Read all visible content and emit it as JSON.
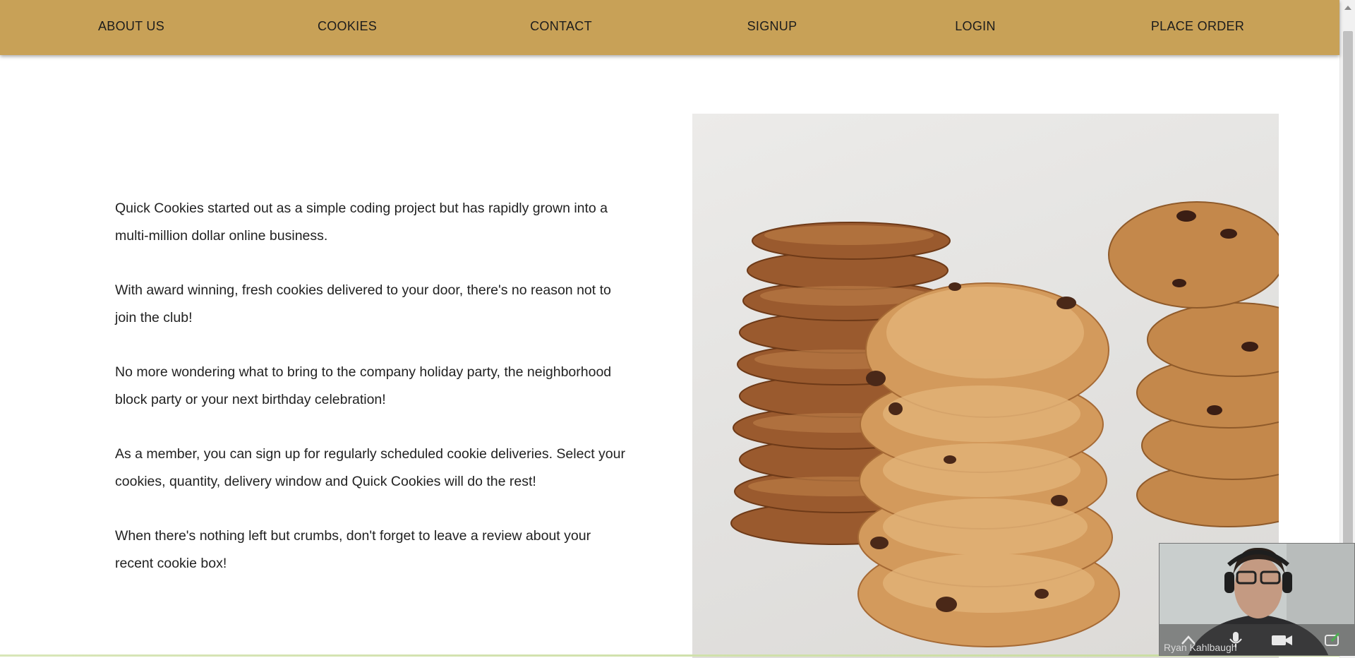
{
  "nav": {
    "items": [
      {
        "label": "ABOUT US"
      },
      {
        "label": "COOKIES"
      },
      {
        "label": "CONTACT"
      },
      {
        "label": "SIGNUP"
      },
      {
        "label": "LOGIN"
      },
      {
        "label": "PLACE ORDER"
      }
    ]
  },
  "about": {
    "paragraphs": [
      "Quick Cookies started out as a simple coding project but has rapidly grown into a multi-million dollar online business.",
      "With award winning, fresh cookies delivered to your door, there's no reason not to join the club!",
      "No more wondering what to bring to the company holiday party, the neighborhood block party or your next birthday celebration!",
      "As a member, you can sign up for regularly scheduled cookie deliveries. Select your cookies, quantity, delivery window and Quick Cookies will do the rest!",
      "When there's nothing left but crumbs, don't forget to leave a review about your recent cookie box!"
    ]
  },
  "video_call": {
    "participant_name": "Ryan Kahlbaugh",
    "controls": [
      "chevron-up-icon",
      "microphone-icon",
      "camera-icon",
      "share-screen-icon"
    ]
  },
  "colors": {
    "nav_background": "#c8a157",
    "text": "#222222"
  }
}
